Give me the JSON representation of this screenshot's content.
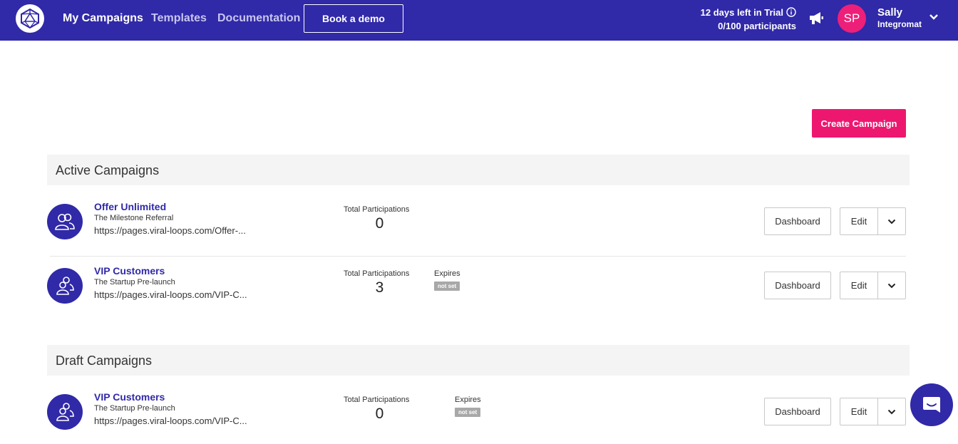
{
  "header": {
    "nav": [
      "My Campaigns",
      "Templates",
      "Documentation"
    ],
    "book_demo": "Book a demo",
    "trial_text": "12 days left in Trial",
    "participants_text": "0/100 participants",
    "user": {
      "initials": "SP",
      "name": "Sally",
      "org": "Integromat"
    }
  },
  "actions": {
    "create_campaign": "Create Campaign"
  },
  "active": {
    "title": "Active Campaigns",
    "campaigns": [
      {
        "name": "Offer Unlimited",
        "type": "The Milestone Referral",
        "url": "https://pages.viral-loops.com/Offer-...",
        "participations_label": "Total Participations",
        "participations": "0",
        "dashboard": "Dashboard",
        "edit": "Edit"
      },
      {
        "name": "VIP Customers",
        "type": "The Startup Pre-launch",
        "url": "https://pages.viral-loops.com/VIP-C...",
        "participations_label": "Total Participations",
        "participations": "3",
        "expires_label": "Expires",
        "expires_value": "not set",
        "dashboard": "Dashboard",
        "edit": "Edit"
      }
    ]
  },
  "draft": {
    "title": "Draft Campaigns",
    "campaigns": [
      {
        "name": "VIP Customers",
        "type": "The Startup Pre-launch",
        "url": "https://pages.viral-loops.com/VIP-C...",
        "participations_label": "Total Participations",
        "participations": "0",
        "expires_label": "Expires",
        "expires_value": "not set",
        "dashboard": "Dashboard",
        "edit": "Edit"
      }
    ]
  },
  "colors": {
    "brand": "#3029a8",
    "accent": "#ee1770",
    "avatar": "#ee1f79"
  },
  "icons": [
    "logo-icon",
    "info-icon",
    "megaphone-icon",
    "chevron-down-icon",
    "users-icon",
    "chat-icon"
  ]
}
